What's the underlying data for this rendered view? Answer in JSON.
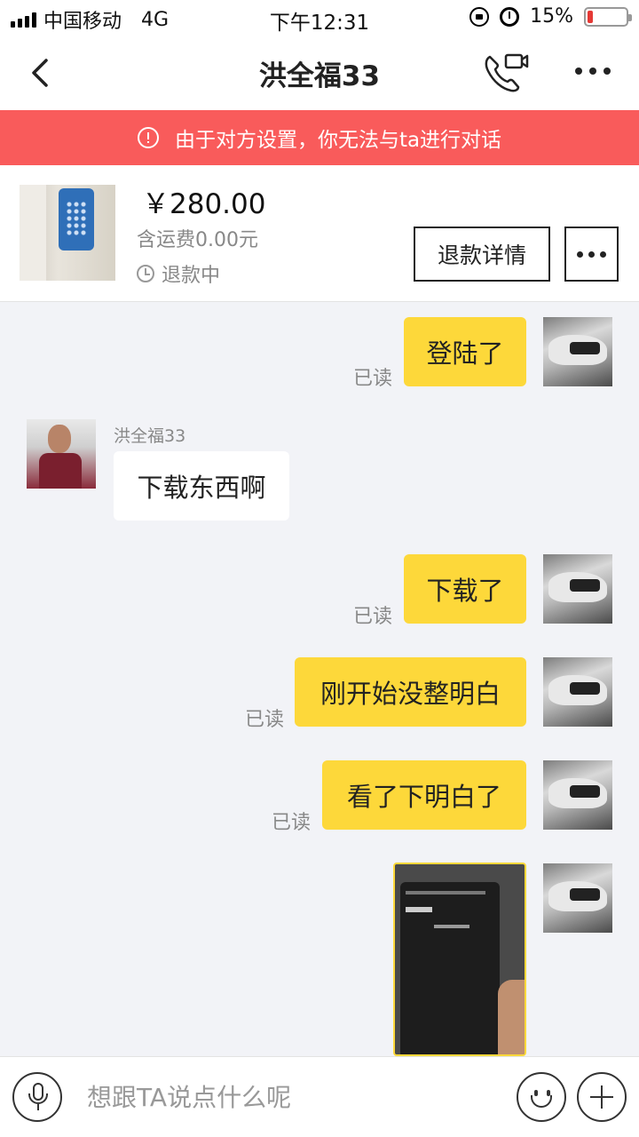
{
  "status_bar": {
    "carrier": "中国移动",
    "network": "4G",
    "time": "下午12:31",
    "battery_percent": "15%",
    "battery_level": 0.15,
    "icons": [
      "signal-icon",
      "rotation-lock-icon",
      "alarm-icon",
      "battery-icon"
    ]
  },
  "nav": {
    "title": "洪全福33",
    "icons": [
      "back-arrow-icon",
      "phone-video-icon",
      "more-icon"
    ]
  },
  "banner": {
    "text": "由于对方设置，你无法与ta进行对话",
    "icon": "info-icon",
    "color": "#f95b5b"
  },
  "product": {
    "price": "￥280.00",
    "shipping": "含运费0.00元",
    "status": "退款中",
    "refund_button": "退款详情"
  },
  "messages": [
    {
      "from": "me",
      "text": "登陆了",
      "read": "已读"
    },
    {
      "from": "them",
      "sender": "洪全福33",
      "text": "下载东西啊"
    },
    {
      "from": "me",
      "text": "下载了",
      "read": "已读"
    },
    {
      "from": "me",
      "text": "刚开始没整明白",
      "read": "已读"
    },
    {
      "from": "me",
      "text": "看了下明白了",
      "read": "已读"
    },
    {
      "from": "me",
      "type": "image"
    }
  ],
  "input": {
    "placeholder": "想跟TA说点什么呢"
  },
  "colors": {
    "my_bubble": "#fdd83a",
    "background": "#f2f3f7",
    "banner": "#f95b5b"
  }
}
